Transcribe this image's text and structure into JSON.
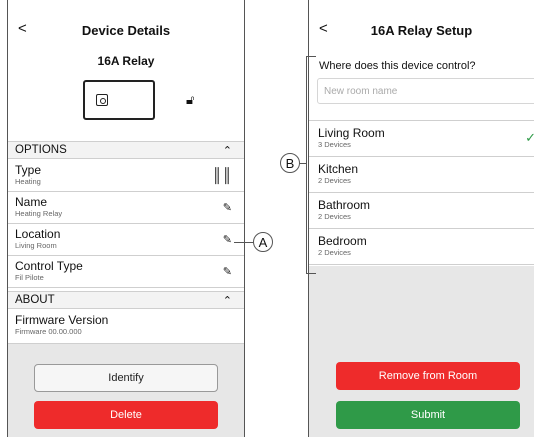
{
  "left": {
    "header_title": "Device Details",
    "back_glyph": "<",
    "device_name": "16A Relay",
    "sections": {
      "options_label": "OPTIONS",
      "about_label": "ABOUT"
    },
    "rows": [
      {
        "title": "Type",
        "sub": "Heating",
        "icon": "radiator-icon"
      },
      {
        "title": "Name",
        "sub": "Heating Relay",
        "icon": "pencil-icon"
      },
      {
        "title": "Location",
        "sub": "Living Room",
        "icon": "pencil-icon"
      },
      {
        "title": "Control Type",
        "sub": "Fil Pilote",
        "icon": "pencil-icon"
      }
    ],
    "firmware": {
      "title": "Firmware Version",
      "sub": "Firmware 00.00.000"
    },
    "identify_label": "Identify",
    "delete_label": "Delete"
  },
  "right": {
    "header_title": "16A Relay Setup",
    "back_glyph": "<",
    "question": "Where does this device control?",
    "room_input_placeholder": "New room name",
    "rooms": [
      {
        "title": "Living Room",
        "sub": "3 Devices",
        "selected": true
      },
      {
        "title": "Kitchen",
        "sub": "2 Devices",
        "selected": false
      },
      {
        "title": "Bathroom",
        "sub": "2 Devices",
        "selected": false
      },
      {
        "title": "Bedroom",
        "sub": "2 Devices",
        "selected": false
      }
    ],
    "remove_label": "Remove from Room",
    "submit_label": "Submit"
  },
  "callouts": {
    "a": "A",
    "b": "B"
  },
  "colors": {
    "red": "#ee2b2b",
    "green": "#2f9a48",
    "check": "#2f9a48"
  }
}
